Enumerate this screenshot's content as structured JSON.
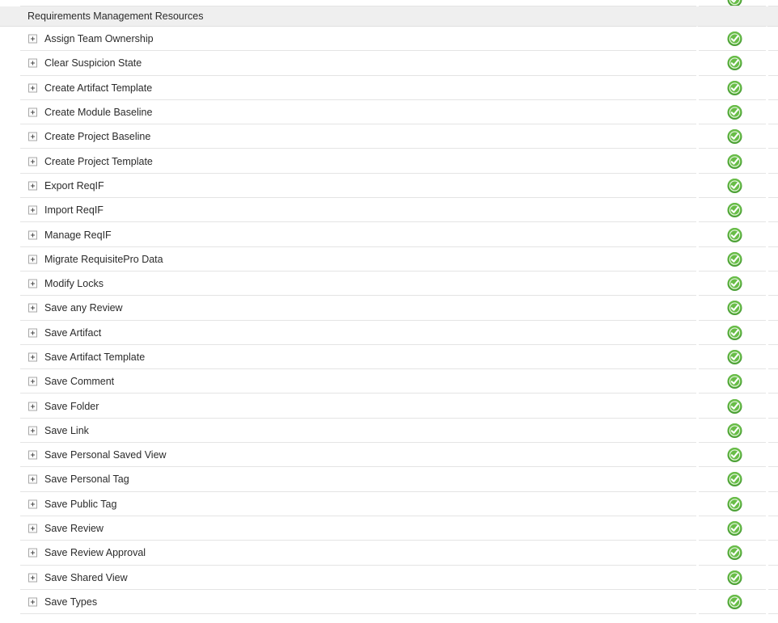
{
  "section": {
    "title": "Requirements Management Resources"
  },
  "icons": {
    "expand": "plus-square-icon",
    "granted": "green-check-circle-icon"
  },
  "colors": {
    "header_background": "#efefef",
    "row_divider": "#e4e4e4",
    "text": "#2b2b2b",
    "check_green_light": "#6dbf4b",
    "check_green_dark": "#3c9130",
    "page_background": "#ffffff"
  },
  "rows": [
    {
      "label": "Assign Team Ownership",
      "status": "granted"
    },
    {
      "label": "Clear Suspicion State",
      "status": "granted"
    },
    {
      "label": "Create Artifact Template",
      "status": "granted"
    },
    {
      "label": "Create Module Baseline",
      "status": "granted"
    },
    {
      "label": "Create Project Baseline",
      "status": "granted"
    },
    {
      "label": "Create Project Template",
      "status": "granted"
    },
    {
      "label": "Export ReqIF",
      "status": "granted"
    },
    {
      "label": "Import ReqIF",
      "status": "granted"
    },
    {
      "label": "Manage ReqIF",
      "status": "granted"
    },
    {
      "label": "Migrate RequisitePro Data",
      "status": "granted"
    },
    {
      "label": "Modify Locks",
      "status": "granted"
    },
    {
      "label": "Save any Review",
      "status": "granted"
    },
    {
      "label": "Save Artifact",
      "status": "granted"
    },
    {
      "label": "Save Artifact Template",
      "status": "granted"
    },
    {
      "label": "Save Comment",
      "status": "granted"
    },
    {
      "label": "Save Folder",
      "status": "granted"
    },
    {
      "label": "Save Link",
      "status": "granted"
    },
    {
      "label": "Save Personal Saved View",
      "status": "granted"
    },
    {
      "label": "Save Personal Tag",
      "status": "granted"
    },
    {
      "label": "Save Public Tag",
      "status": "granted"
    },
    {
      "label": "Save Review",
      "status": "granted"
    },
    {
      "label": "Save Review Approval",
      "status": "granted"
    },
    {
      "label": "Save Shared View",
      "status": "granted"
    },
    {
      "label": "Save Types",
      "status": "granted"
    }
  ]
}
